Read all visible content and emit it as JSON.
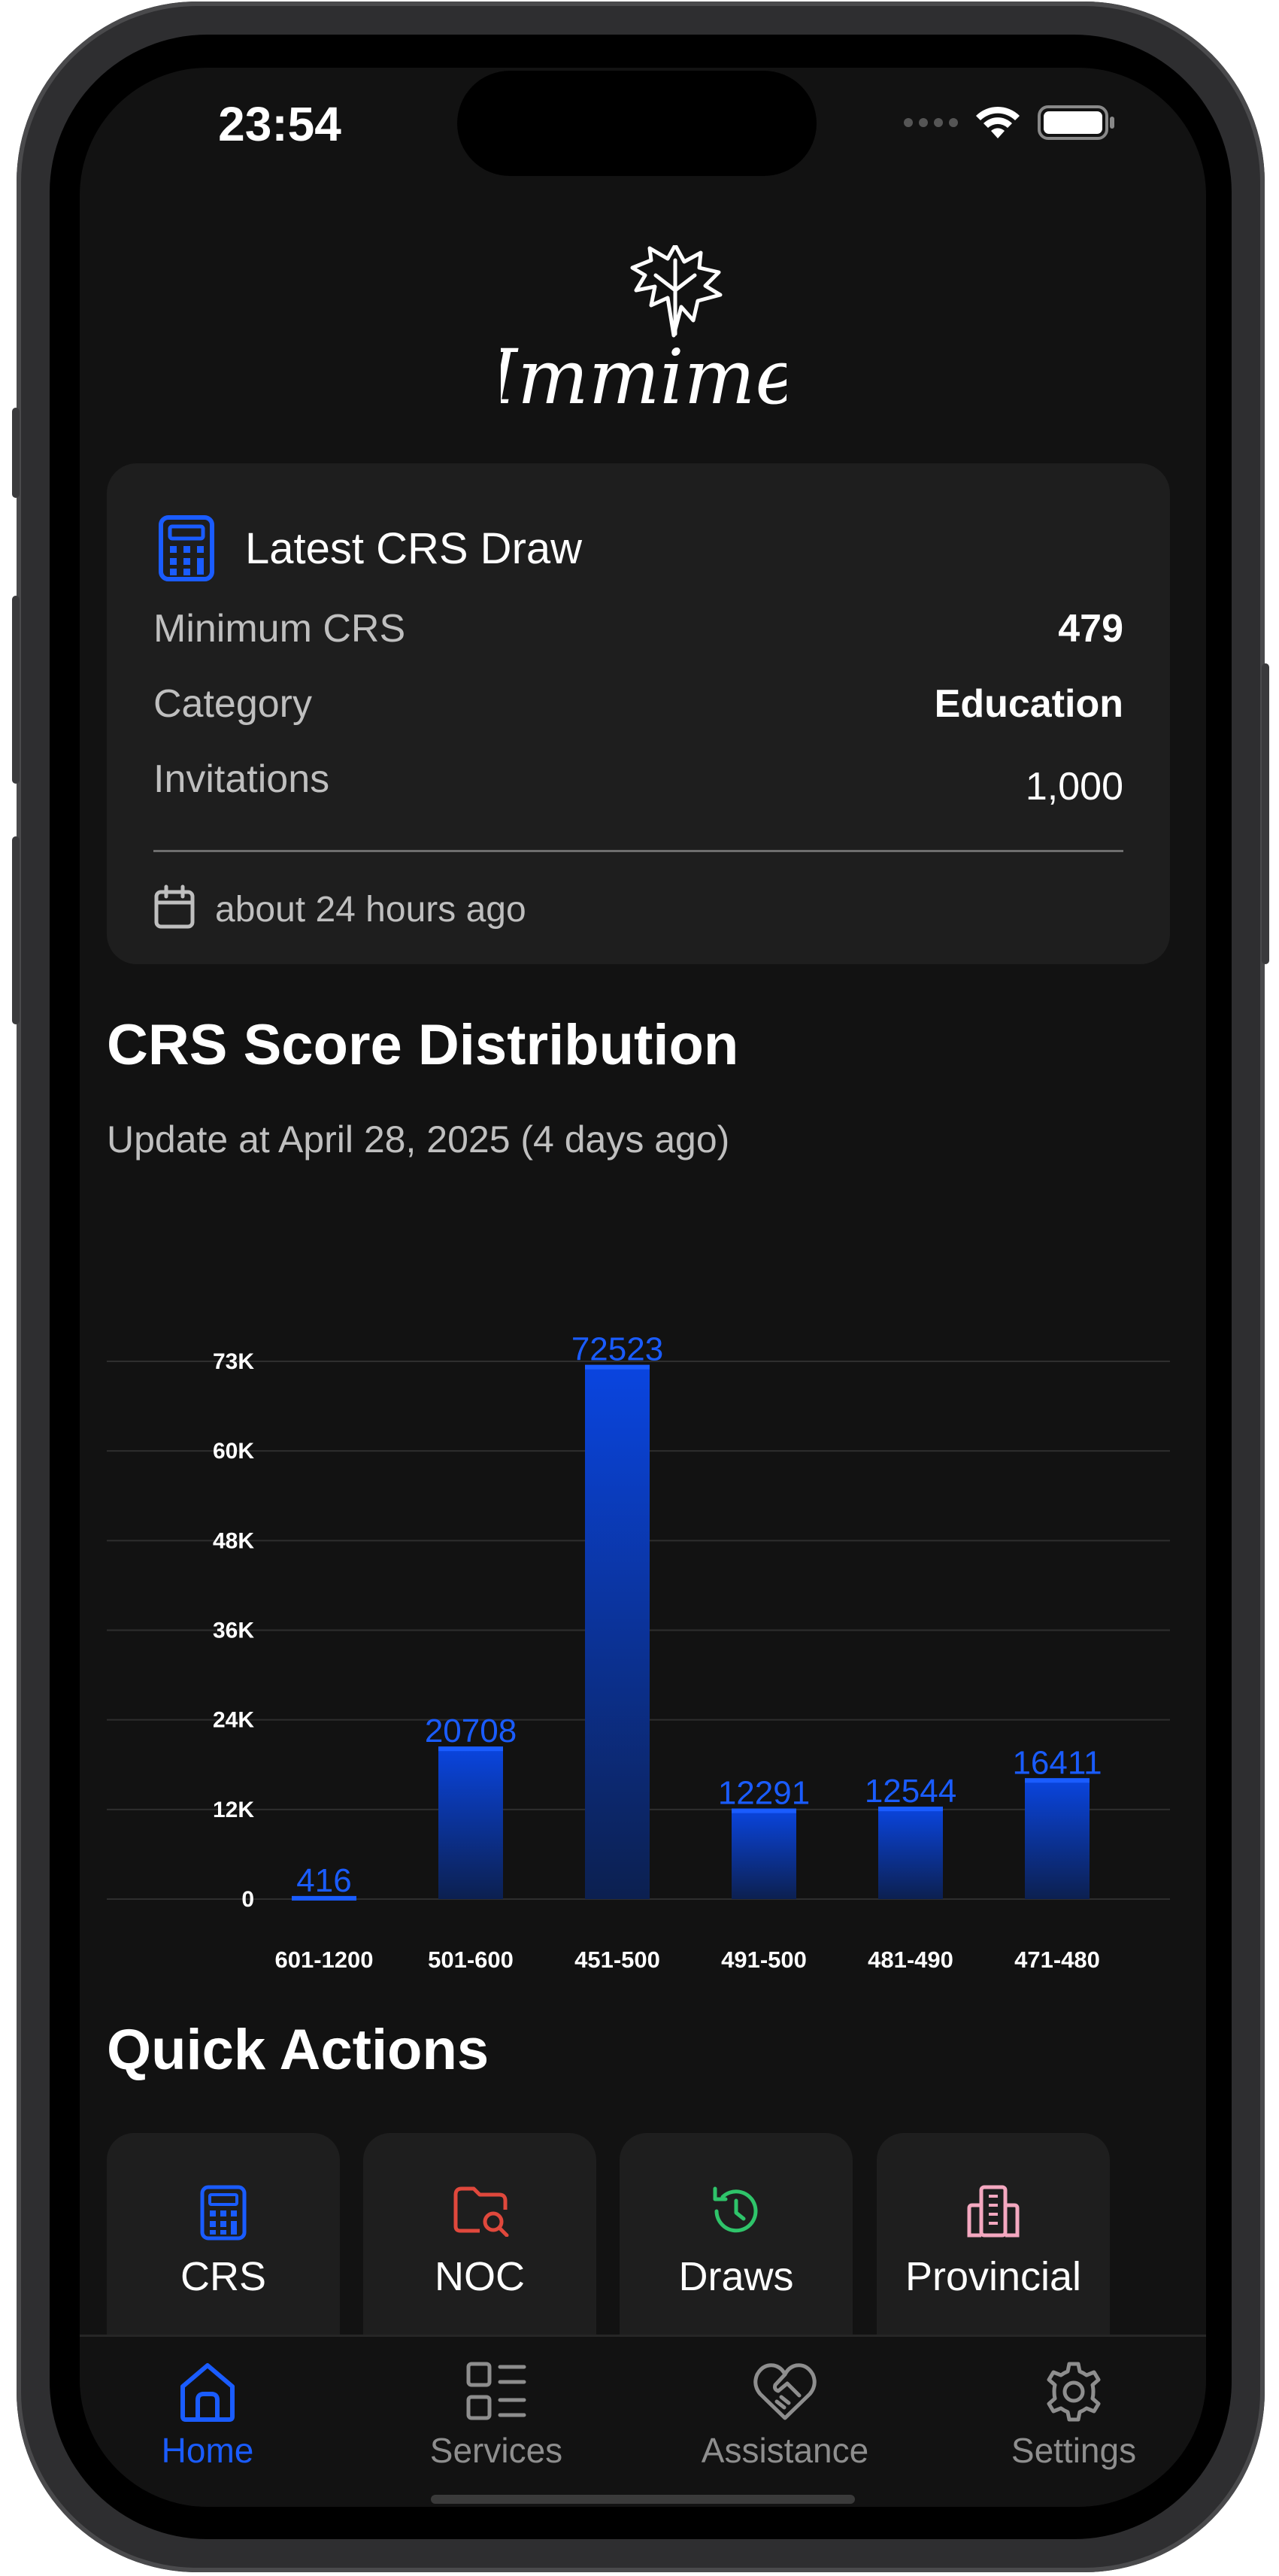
{
  "status": {
    "time": "23:54"
  },
  "brand": {
    "name": "Immime"
  },
  "latest_draw": {
    "title": "Latest CRS Draw",
    "rows": [
      {
        "label": "Minimum CRS",
        "value": "479"
      },
      {
        "label": "Category",
        "value": "Education"
      },
      {
        "label": "Invitations",
        "value": "1,000"
      }
    ],
    "updated": "about 24 hours ago"
  },
  "distribution": {
    "title": "CRS Score Distribution",
    "subtitle": "Update at April 28, 2025 (4 days ago)"
  },
  "chart_data": {
    "type": "bar",
    "categories": [
      "601-1200",
      "501-600",
      "451-500",
      "491-500",
      "481-490",
      "471-480"
    ],
    "values": [
      416,
      20708,
      72523,
      12291,
      12544,
      16411
    ],
    "yticks": [
      "0",
      "12K",
      "24K",
      "36K",
      "48K",
      "60K",
      "73K"
    ],
    "ylim": [
      0,
      73000
    ],
    "grid": true,
    "bar_color": "#0a3bd6",
    "label_color": "#1a5cff"
  },
  "quick_actions": {
    "title": "Quick Actions",
    "items": [
      {
        "label": "CRS",
        "icon": "calculator-icon",
        "color": "#1a5cff"
      },
      {
        "label": "NOC",
        "icon": "folder-search-icon",
        "color": "#e0483c"
      },
      {
        "label": "Draws",
        "icon": "history-icon",
        "color": "#2fc46a"
      },
      {
        "label": "Provincial",
        "icon": "building-icon",
        "color": "#f4a8c0"
      }
    ]
  },
  "tabs": [
    {
      "label": "Home",
      "icon": "home-icon",
      "active": true
    },
    {
      "label": "Services",
      "icon": "grid-list-icon",
      "active": false
    },
    {
      "label": "Assistance",
      "icon": "heart-handshake-icon",
      "active": false
    },
    {
      "label": "Settings",
      "icon": "gear-icon",
      "active": false
    }
  ],
  "colors": {
    "accent": "#1a5cff",
    "background": "#121212",
    "card": "#1e1e1e"
  }
}
